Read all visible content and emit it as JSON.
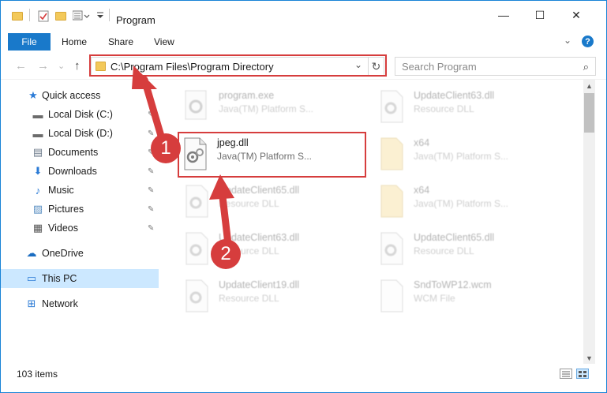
{
  "window": {
    "title": "Program",
    "minimize_glyph": "—",
    "maximize_glyph": "☐",
    "close_glyph": "✕"
  },
  "ribbon": {
    "file_label": "File",
    "tabs": [
      "Home",
      "Share",
      "View"
    ],
    "help_glyph": "?",
    "collapse_glyph": "⌄"
  },
  "nav": {
    "back_glyph": "←",
    "forward_glyph": "→",
    "recent_glyph": "⌄",
    "up_glyph": "↑"
  },
  "address": {
    "path": "C:\\Program Files\\Program Directory",
    "dropdown_glyph": "⌄",
    "refresh_glyph": "↻"
  },
  "search": {
    "placeholder": "Search Program",
    "icon": "search-icon",
    "icon_glyph": "⌕"
  },
  "sidebar": {
    "items": [
      {
        "label": "Quick access",
        "icon": "star-icon",
        "glyph": "★",
        "color": "#2b7bd6",
        "pinned": false
      },
      {
        "label": "Local Disk (C:)",
        "icon": "drive-icon",
        "glyph": "▬",
        "color": "#6c6c6c",
        "pinned": true
      },
      {
        "label": "Local Disk (D:)",
        "icon": "drive-icon",
        "glyph": "▬",
        "color": "#6c6c6c",
        "pinned": true
      },
      {
        "label": "Documents",
        "icon": "documents-icon",
        "glyph": "▤",
        "color": "#6c7a8a",
        "pinned": true
      },
      {
        "label": "Downloads",
        "icon": "download-icon",
        "glyph": "⬇",
        "color": "#2b7bd6",
        "pinned": true
      },
      {
        "label": "Music",
        "icon": "music-icon",
        "glyph": "♪",
        "color": "#2b7bd6",
        "pinned": true
      },
      {
        "label": "Pictures",
        "icon": "pictures-icon",
        "glyph": "▨",
        "color": "#5a8fc2",
        "pinned": true
      },
      {
        "label": "Videos",
        "icon": "videos-icon",
        "glyph": "▦",
        "color": "#555555",
        "pinned": true
      },
      {
        "label": "OneDrive",
        "icon": "cloud-icon",
        "glyph": "☁",
        "color": "#1b6dc1",
        "pinned": false
      },
      {
        "label": "This PC",
        "icon": "computer-icon",
        "glyph": "▭",
        "color": "#2b7bd6",
        "pinned": false,
        "selected": true
      },
      {
        "label": "Network",
        "icon": "network-icon",
        "glyph": "⊞",
        "color": "#2b7bd6",
        "pinned": false
      }
    ],
    "pin_glyph": "📌"
  },
  "files": [
    {
      "name": "program.exe",
      "type": "Java(TM) Platform S...",
      "icon": "exe-gear-icon",
      "faded": true
    },
    {
      "name": "UpdateClient63.dll",
      "type": "Resource DLL",
      "icon": "dll-gear-icon",
      "faded": true
    },
    {
      "name": "jpeg.dll",
      "type": "Java(TM) Platform S...",
      "icon": "dll-gear-icon",
      "faded": false
    },
    {
      "name": "x64",
      "type": "Java(TM) Platform S...",
      "icon": "folder-file-icon",
      "faded": true
    },
    {
      "name": "UpdateClient65.dll",
      "type": "Resource DLL",
      "icon": "dll-gear-icon",
      "faded": true
    },
    {
      "name": "x64",
      "type": "Java(TM) Platform S...",
      "icon": "folder-file-icon",
      "faded": true
    },
    {
      "name": "UpdateClient63.dll",
      "type": "Resource DLL",
      "icon": "dll-gear-icon",
      "faded": true
    },
    {
      "name": "UpdateClient65.dll",
      "type": "Resource DLL",
      "icon": "dll-gear-icon",
      "faded": true
    },
    {
      "name": "UpdateClient19.dll",
      "type": "Resource DLL",
      "icon": "dll-gear-icon",
      "faded": true
    },
    {
      "name": "SndToWP12.wcm",
      "type": "WCM File",
      "icon": "blank-file-icon",
      "faded": true
    }
  ],
  "status": {
    "item_count": "103 items"
  },
  "annotations": {
    "step1": "1",
    "step2": "2",
    "color": "#d63d3d"
  },
  "colors": {
    "accent": "#1979ca",
    "selection": "#cce8ff",
    "highlight_red": "#d63d3d"
  }
}
